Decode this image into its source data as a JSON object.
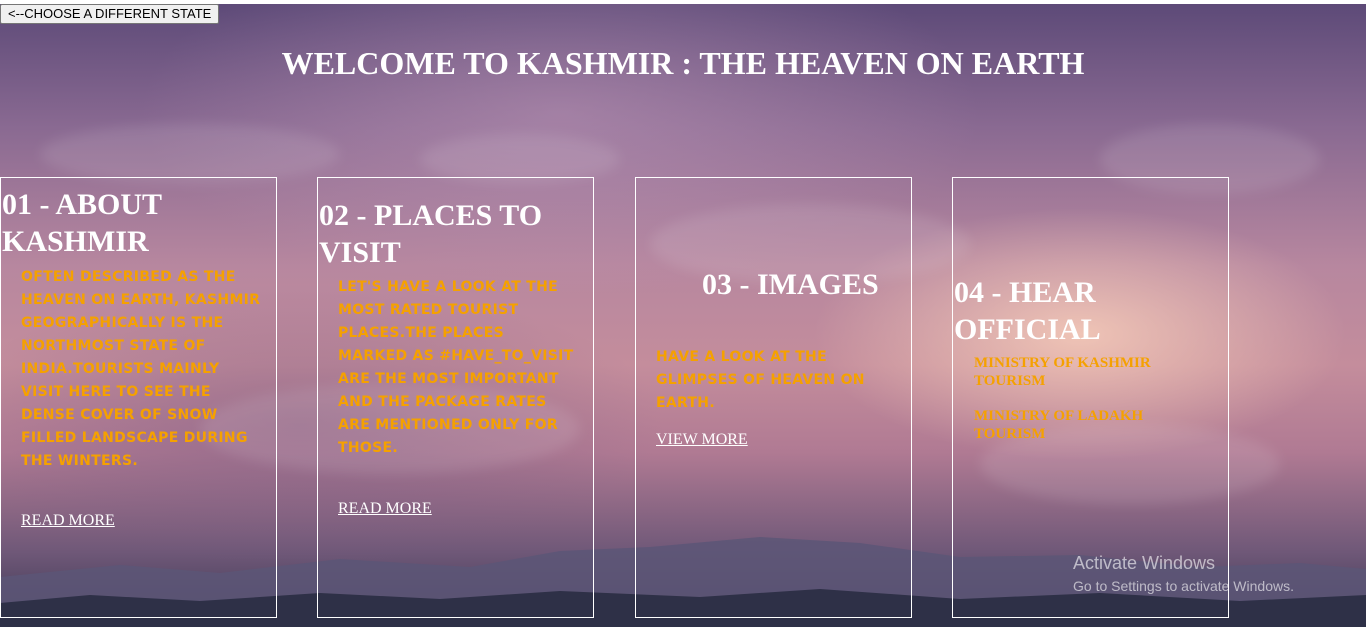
{
  "nav": {
    "back_label": "<--CHOOSE A DIFFERENT STATE"
  },
  "header": {
    "title": "WELCOME TO KASHMIR : THE HEAVEN ON EARTH"
  },
  "cards": [
    {
      "heading": "01 - ABOUT KASHMIR",
      "description": "Often described as the heaven on earth, Kashmir geographically is the northmost state of India.Tourists mainly visit here to see the dense cover of snow filled landscape during the winters.",
      "link": "READ MORE"
    },
    {
      "heading": "02 - PLACES TO VISIT",
      "description": "Let's have a look at the most rated tourist places.The places marked as #have_to_visit are the most important and the package rates are mentioned only for those.",
      "link": "READ MORE"
    },
    {
      "heading": "03 - IMAGES",
      "description": "Have a look at the glimpses of heaven on earth.",
      "link": "VIEW MORE"
    },
    {
      "heading": "04 - HEAR OFFICIAL",
      "links": [
        "MINISTRY OF KASHMIR TOURISM",
        "MINISTRY OF LADAKH TOURISM"
      ]
    }
  ],
  "watermark": {
    "title": "Activate Windows",
    "subtitle": "Go to Settings to activate Windows."
  },
  "colors": {
    "accent": "#f5a100",
    "heading": "#ffffff"
  }
}
